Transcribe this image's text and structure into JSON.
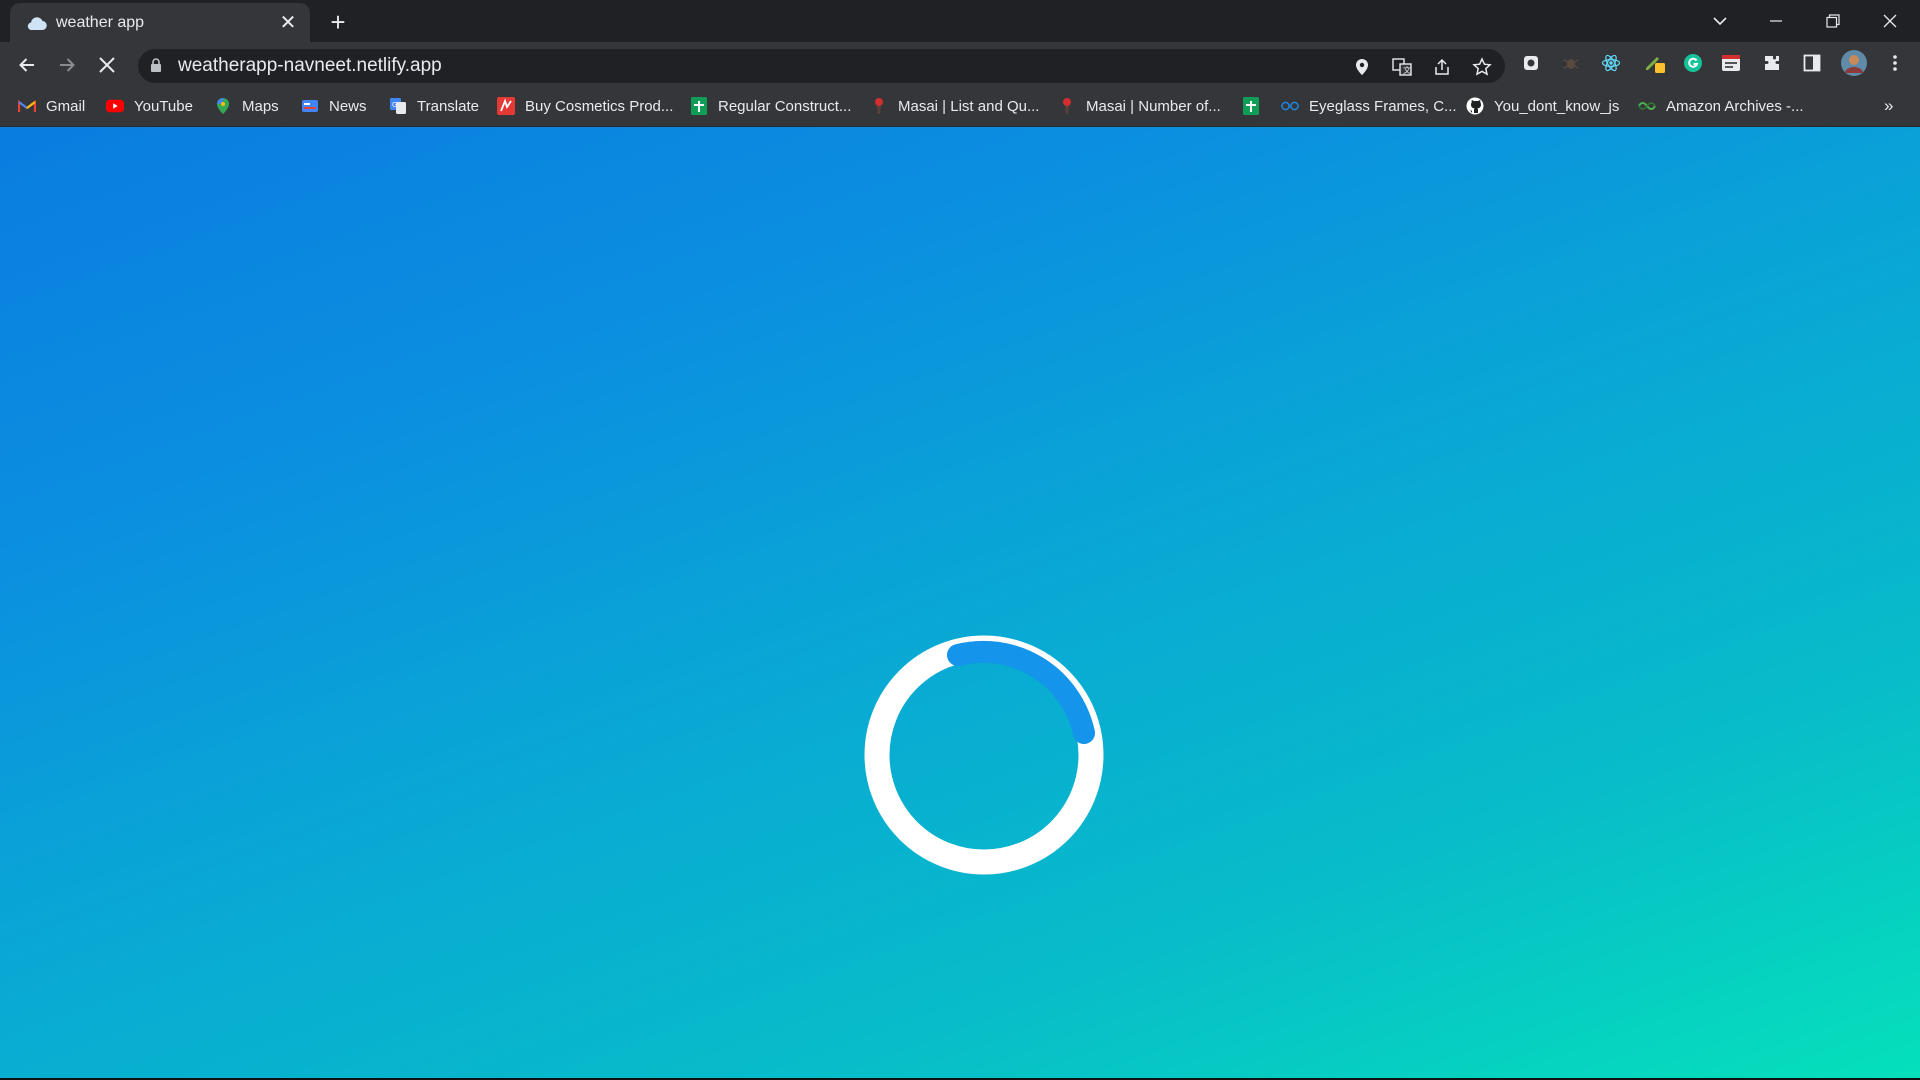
{
  "browser": {
    "tab": {
      "title": "weather app",
      "close_glyph": "✕"
    },
    "new_tab_glyph": "+",
    "url": "weatherapp-navneet.netlify.app",
    "overflow_glyph": "»",
    "bookmarks": [
      {
        "label": "Gmail",
        "icon": "gmail-icon",
        "color": "#ea4335"
      },
      {
        "label": "YouTube",
        "icon": "youtube-icon",
        "color": "#ff0000"
      },
      {
        "label": "Maps",
        "icon": "maps-icon",
        "color": "#34a853"
      },
      {
        "label": "News",
        "icon": "news-icon",
        "color": "#4285f4"
      },
      {
        "label": "Translate",
        "icon": "translate-icon",
        "color": "#4285f4"
      },
      {
        "label": "Buy Cosmetics Prod...",
        "icon": "cosmetics-icon",
        "color": "#e53935"
      },
      {
        "label": "Regular Construct...",
        "icon": "sheets-icon",
        "color": "#0f9d58"
      },
      {
        "label": "Masai | List and Qu...",
        "icon": "masai-icon",
        "color": "#d32f2f"
      },
      {
        "label": "Masai | Number of...",
        "icon": "masai-icon",
        "color": "#d32f2f"
      },
      {
        "label": "",
        "icon": "sheets-icon",
        "color": "#0f9d58"
      },
      {
        "label": "Eyeglass Frames, C...",
        "icon": "eyeglass-icon",
        "color": "#1e88e5"
      },
      {
        "label": "You_dont_know_js",
        "icon": "github-icon",
        "color": "#ffffff"
      },
      {
        "label": "Amazon Archives -...",
        "icon": "amazon-icon",
        "color": "#4caf50"
      }
    ]
  },
  "page": {
    "state": "loading",
    "background_gradient": [
      "#0a7de0",
      "#05e0bb"
    ],
    "spinner": {
      "track_color": "#ffffff",
      "arc_color": "#1494ea"
    }
  }
}
